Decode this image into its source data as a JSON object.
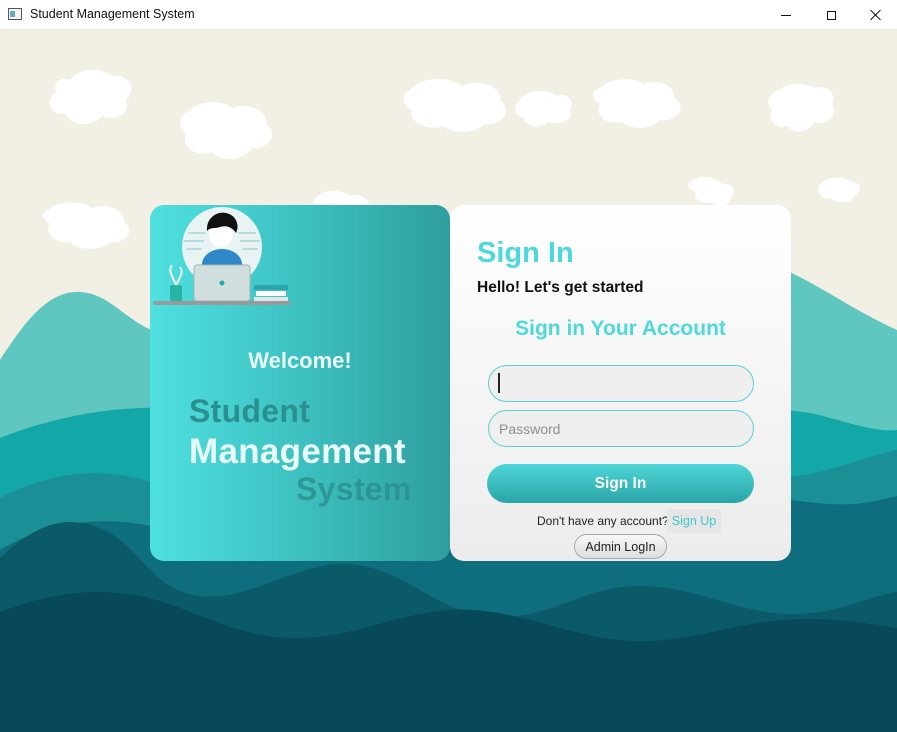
{
  "window": {
    "title": "Student Management System",
    "controls": [
      "minimize-icon",
      "maximize-icon",
      "close-icon"
    ]
  },
  "welcome": {
    "greeting": "Welcome!",
    "brand_line1": "Student",
    "brand_line2": "Management",
    "brand_line3": "System"
  },
  "signin": {
    "heading": "Sign In",
    "subheading": "Hello! Let's get started",
    "account_heading": "Sign in Your Account",
    "username": {
      "value": "",
      "placeholder": ""
    },
    "password": {
      "value": "",
      "placeholder": "Password"
    },
    "submit_label": "Sign In",
    "no_account_text": "Don't have any account?",
    "signup_label": "Sign Up",
    "admin_label": "Admin LogIn"
  },
  "colors": {
    "accent": "#4dd9dc",
    "card_teal": "#3fc4c4",
    "sky": "#f2efe4",
    "deep_teal": "#063d52"
  }
}
